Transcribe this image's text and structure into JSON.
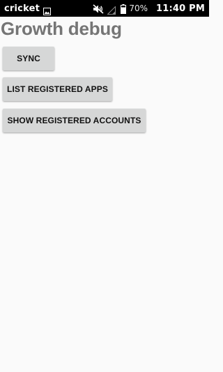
{
  "status_bar": {
    "carrier": "cricket",
    "battery_percent": "70%",
    "time": "11:40 PM",
    "icons": [
      "gallery-icon",
      "mute-icon",
      "signal-icon",
      "battery-icon"
    ]
  },
  "page": {
    "title": "Growth debug"
  },
  "buttons": {
    "sync": "SYNC",
    "list_registered_apps": "LIST REGISTERED APPS",
    "show_registered_accounts": "SHOW REGISTERED ACCOUNTS"
  },
  "colors": {
    "background": "#fafafa",
    "status_bar": "#000000",
    "title": "#757575",
    "button_bg": "#d6d7d7",
    "button_text": "#111111"
  }
}
